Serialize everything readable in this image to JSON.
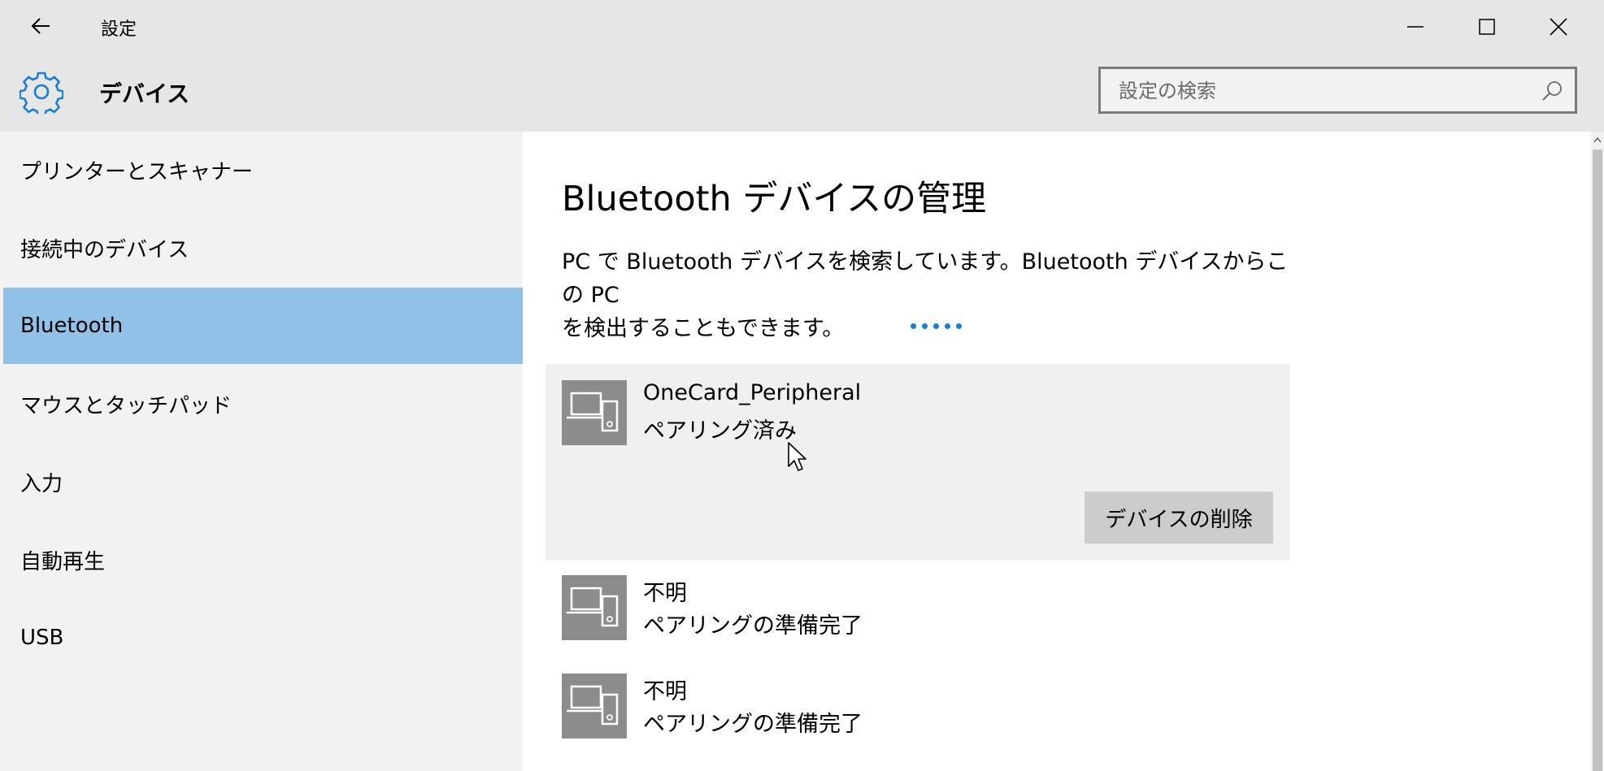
{
  "window": {
    "title": "設定",
    "back_icon": "back-arrow-icon",
    "controls": {
      "minimize_icon": "minimize-icon",
      "maximize_icon": "maximize-icon",
      "close_icon": "close-icon"
    }
  },
  "header": {
    "icon": "gear-icon",
    "title": "デバイス",
    "search": {
      "placeholder": "設定の検索",
      "value": "",
      "icon": "search-icon"
    }
  },
  "sidebar": {
    "items": [
      {
        "label": "プリンターとスキャナー",
        "active": false
      },
      {
        "label": "接続中のデバイス",
        "active": false
      },
      {
        "label": "Bluetooth",
        "active": true
      },
      {
        "label": "マウスとタッチパッド",
        "active": false
      },
      {
        "label": "入力",
        "active": false
      },
      {
        "label": "自動再生",
        "active": false
      },
      {
        "label": "USB",
        "active": false
      }
    ]
  },
  "main": {
    "title": "Bluetooth デバイスの管理",
    "description_line1": "PC で Bluetooth デバイスを検索しています。Bluetooth デバイスからこの PC",
    "description_line2": "を検出することもできます。",
    "searching_indicator": "progress-dots",
    "devices": [
      {
        "name": "OneCard_Peripheral",
        "status": "ペアリング済み",
        "icon": "device-icon",
        "selected": true,
        "action_label": "デバイスの削除"
      },
      {
        "name": "不明",
        "status": "ペアリングの準備完了",
        "icon": "device-icon",
        "selected": false
      },
      {
        "name": "不明",
        "status": "ペアリングの準備完了",
        "icon": "device-icon",
        "selected": false
      }
    ]
  },
  "colors": {
    "titlebar_bg": "#e6e6e6",
    "sidebar_bg": "#f2f2f2",
    "active_nav_bg": "#91c1e6",
    "accent_blue": "#1a7fd4",
    "device_icon_bg": "#8c8c8c",
    "selected_card_bg": "#f0f0f0",
    "button_bg": "#cccccc"
  }
}
